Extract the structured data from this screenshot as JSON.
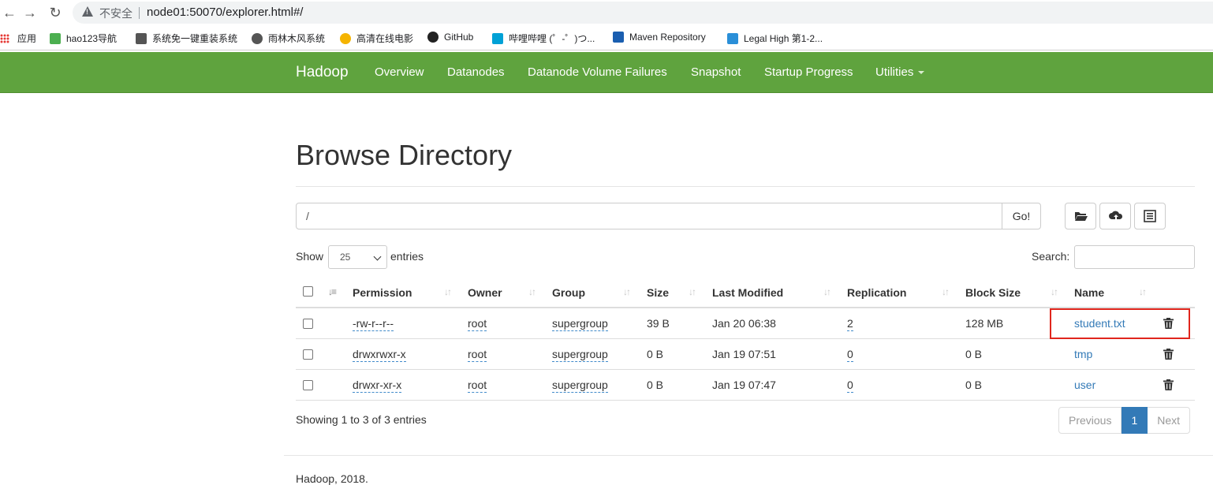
{
  "browser": {
    "insecure_label": "不安全",
    "url": "node01:50070/explorer.html#/",
    "bookmarks": [
      {
        "label": "应用",
        "icon": "apps-icon",
        "color": "#e53935"
      },
      {
        "label": "hao123导航",
        "icon": "hao123-icon",
        "color": "#4caf50"
      },
      {
        "label": "系统免一键重装系统",
        "icon": "system-icon",
        "color": "#555555"
      },
      {
        "label": "雨林木风系统",
        "icon": "globe-icon",
        "color": "#555555"
      },
      {
        "label": "高清在线电影",
        "icon": "movie-icon",
        "color": "#f5b400"
      },
      {
        "label": "GitHub",
        "icon": "github-icon",
        "color": "#222222"
      },
      {
        "label": "哔哩哔哩 (゜-゜)つ...",
        "icon": "bilibili-icon",
        "color": "#00a1d6"
      },
      {
        "label": "Maven Repository",
        "icon": "maven-icon",
        "color": "#1a5eb0"
      },
      {
        "label": "Legal High 第1-2...",
        "icon": "dd-icon",
        "color": "#2a8fd8"
      }
    ]
  },
  "navbar": {
    "brand": "Hadoop",
    "items": [
      "Overview",
      "Datanodes",
      "Datanode Volume Failures",
      "Snapshot",
      "Startup Progress",
      "Utilities"
    ],
    "color": "#5fa33e"
  },
  "page": {
    "title": "Browse Directory",
    "path_value": "/",
    "go_label": "Go!",
    "show_label": "Show",
    "page_length": "25",
    "entries_label": "entries",
    "search_label": "Search:"
  },
  "table": {
    "headers": [
      "Permission",
      "Owner",
      "Group",
      "Size",
      "Last Modified",
      "Replication",
      "Block Size",
      "Name"
    ],
    "rows": [
      {
        "permission": "-rw-r--r--",
        "owner": "root",
        "group": "supergroup",
        "size": "39 B",
        "modified": "Jan 20 06:38",
        "replication": "2",
        "block_size": "128 MB",
        "name": "student.txt"
      },
      {
        "permission": "drwxrwxr-x",
        "owner": "root",
        "group": "supergroup",
        "size": "0 B",
        "modified": "Jan 19 07:51",
        "replication": "0",
        "block_size": "0 B",
        "name": "tmp"
      },
      {
        "permission": "drwxr-xr-x",
        "owner": "root",
        "group": "supergroup",
        "size": "0 B",
        "modified": "Jan 19 07:47",
        "replication": "0",
        "block_size": "0 B",
        "name": "user"
      }
    ],
    "info": "Showing 1 to 3 of 3 entries",
    "pager": {
      "previous": "Previous",
      "current": "1",
      "next": "Next"
    }
  },
  "footer": "Hadoop, 2018."
}
